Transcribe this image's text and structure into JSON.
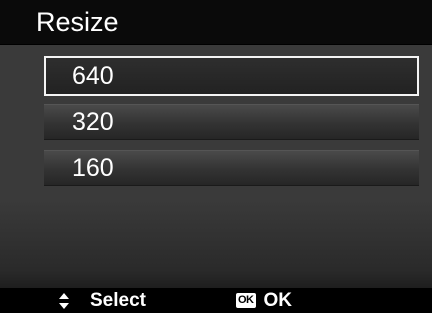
{
  "header": {
    "title": "Resize"
  },
  "menu": {
    "items": [
      {
        "label": "640",
        "selected": true
      },
      {
        "label": "320",
        "selected": false
      },
      {
        "label": "160",
        "selected": false
      }
    ]
  },
  "footer": {
    "select_icon": "up-down-arrows-icon",
    "select_label": "Select",
    "ok_icon_text": "OK",
    "ok_label": "OK"
  },
  "colors": {
    "background": "#3a3a3a",
    "title_bar": "#0a0a0a",
    "text": "#ffffff",
    "selection_border": "#f4f4f4"
  }
}
